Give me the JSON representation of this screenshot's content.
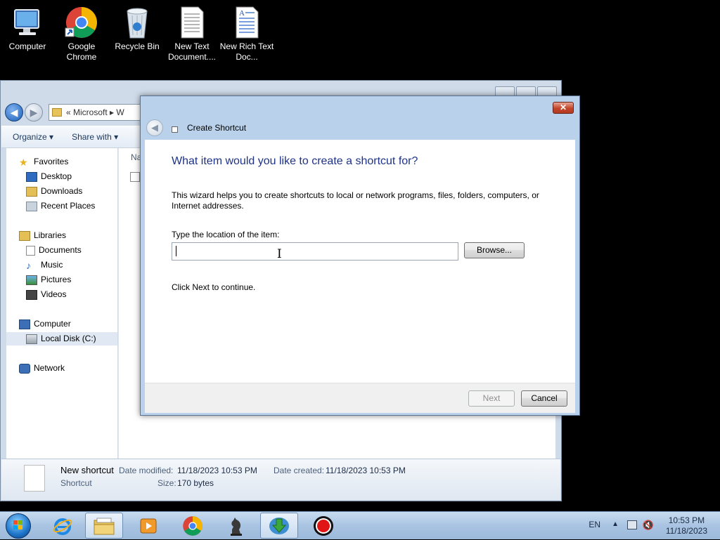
{
  "desktop": {
    "icons": [
      {
        "label": "Computer",
        "icon": "computer-icon"
      },
      {
        "label": "Google Chrome",
        "icon": "chrome-icon"
      },
      {
        "label": "Recycle Bin",
        "icon": "recycle-bin-icon"
      },
      {
        "label": "New Text Document....",
        "icon": "text-document-icon"
      },
      {
        "label": "New Rich Text Doc...",
        "icon": "rich-text-document-icon"
      }
    ]
  },
  "explorer": {
    "address": "« Microsoft ▸ W",
    "toolbar": {
      "organize": "Organize ▾",
      "share_with": "Share with ▾"
    },
    "column_header_partial": "Na",
    "nav": {
      "favorites": "Favorites",
      "desktop": "Desktop",
      "downloads": "Downloads",
      "recent_places": "Recent Places",
      "libraries": "Libraries",
      "documents": "Documents",
      "music": "Music",
      "pictures": "Pictures",
      "videos": "Videos",
      "computer": "Computer",
      "local_disk": "Local Disk (C:)",
      "network": "Network"
    },
    "details": {
      "name": "New shortcut",
      "type": "Shortcut",
      "date_modified_label": "Date modified:",
      "date_modified": "11/18/2023 10:53 PM",
      "date_created_label": "Date created:",
      "date_created": "11/18/2023 10:53 PM",
      "size_label": "Size:",
      "size": "170 bytes"
    }
  },
  "wizard": {
    "title": "Create Shortcut",
    "close_glyph": "✕",
    "heading": "What item would you like to create a shortcut for?",
    "description": "This wizard helps you to create shortcuts to local or network programs, files, folders, computers, or Internet addresses.",
    "location_label": "Type the location of the item:",
    "location_value": "",
    "browse_label": "Browse...",
    "continue_text": "Click Next to continue.",
    "next_label": "Next",
    "cancel_label": "Cancel"
  },
  "taskbar": {
    "language": "EN",
    "time": "10:53 PM",
    "date": "11/18/2023"
  }
}
